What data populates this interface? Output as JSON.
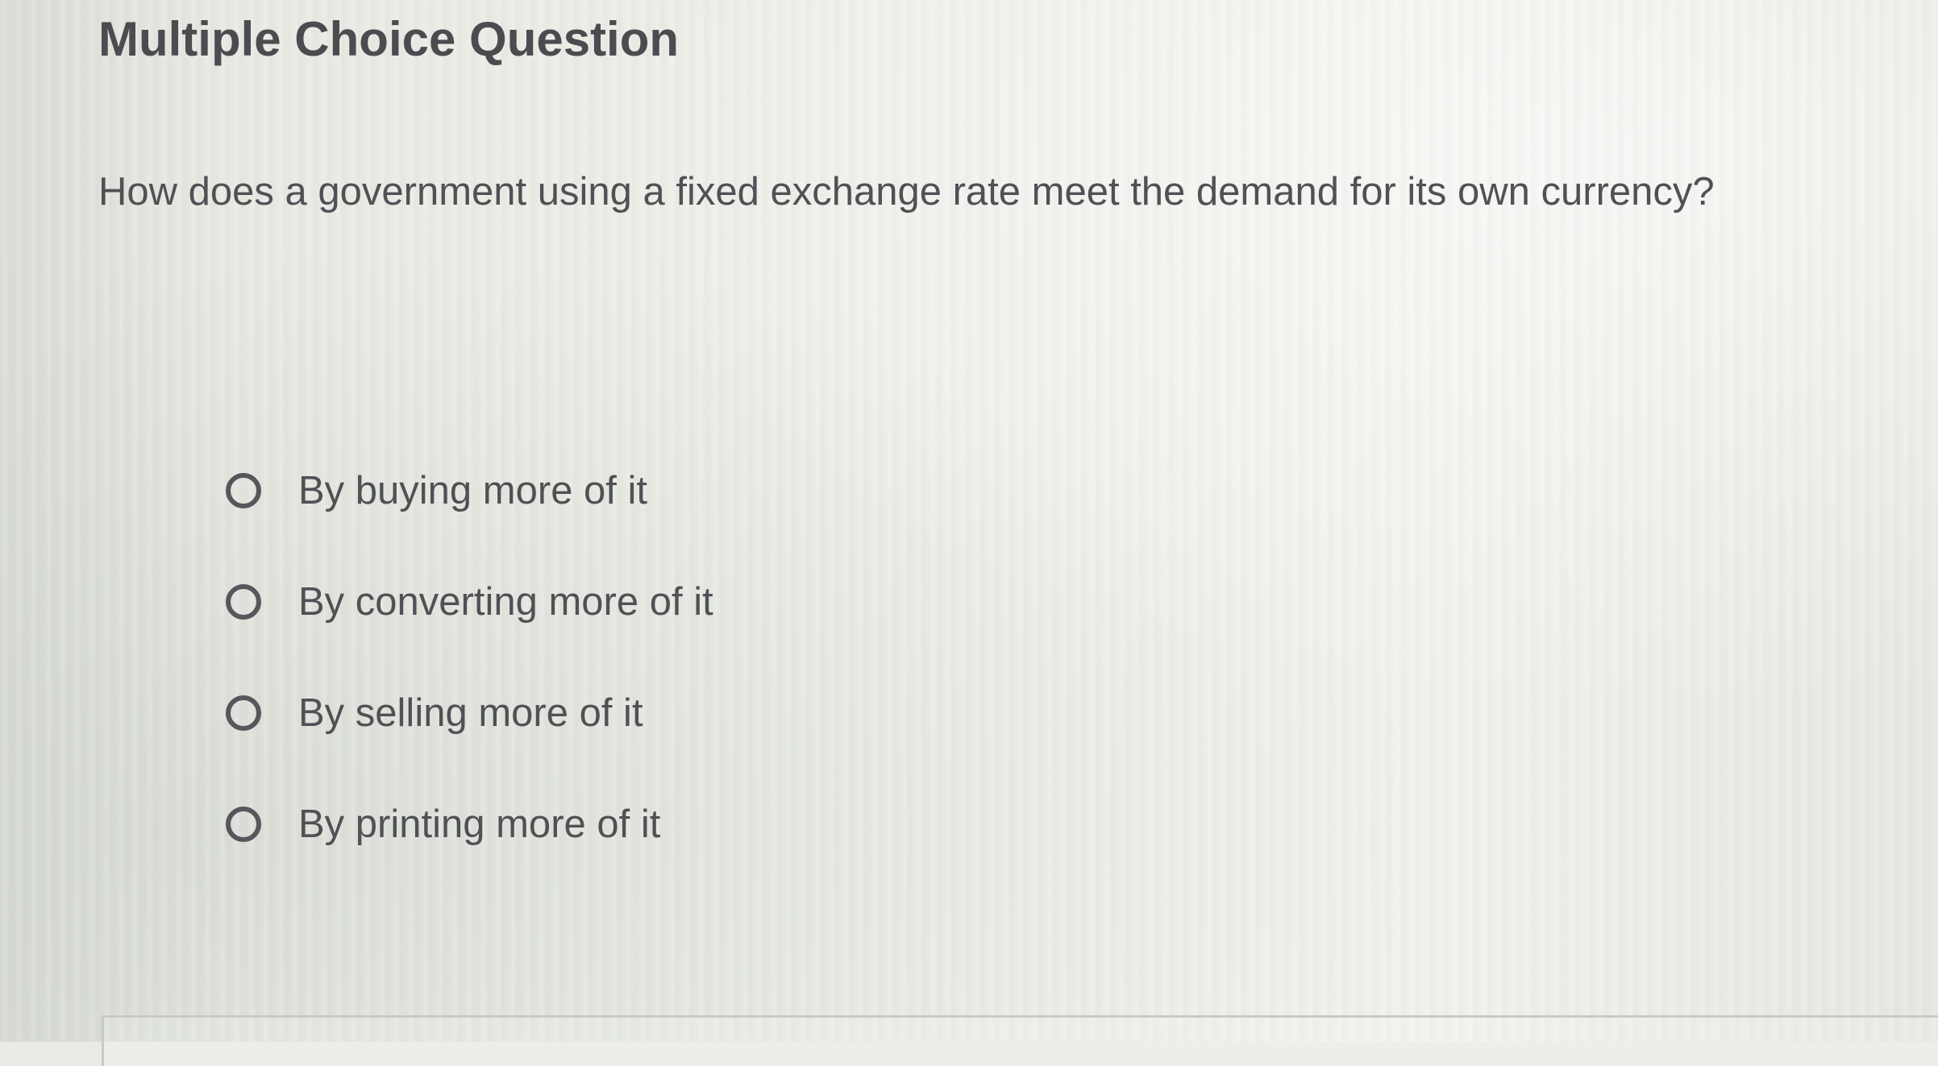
{
  "question_panel": {
    "heading": "Multiple Choice Question",
    "prompt": "How does a government using a fixed exchange rate meet the demand for its own currency?",
    "options": [
      {
        "label": "By buying more of it",
        "selected": false
      },
      {
        "label": "By converting more of it",
        "selected": false
      },
      {
        "label": "By selling more of it",
        "selected": false
      },
      {
        "label": "By printing more of it",
        "selected": false
      }
    ]
  },
  "colors": {
    "background": "#e9ebe4",
    "text": "#4f5155",
    "heading": "#4a4c4f",
    "radio_border": "#55575b"
  }
}
